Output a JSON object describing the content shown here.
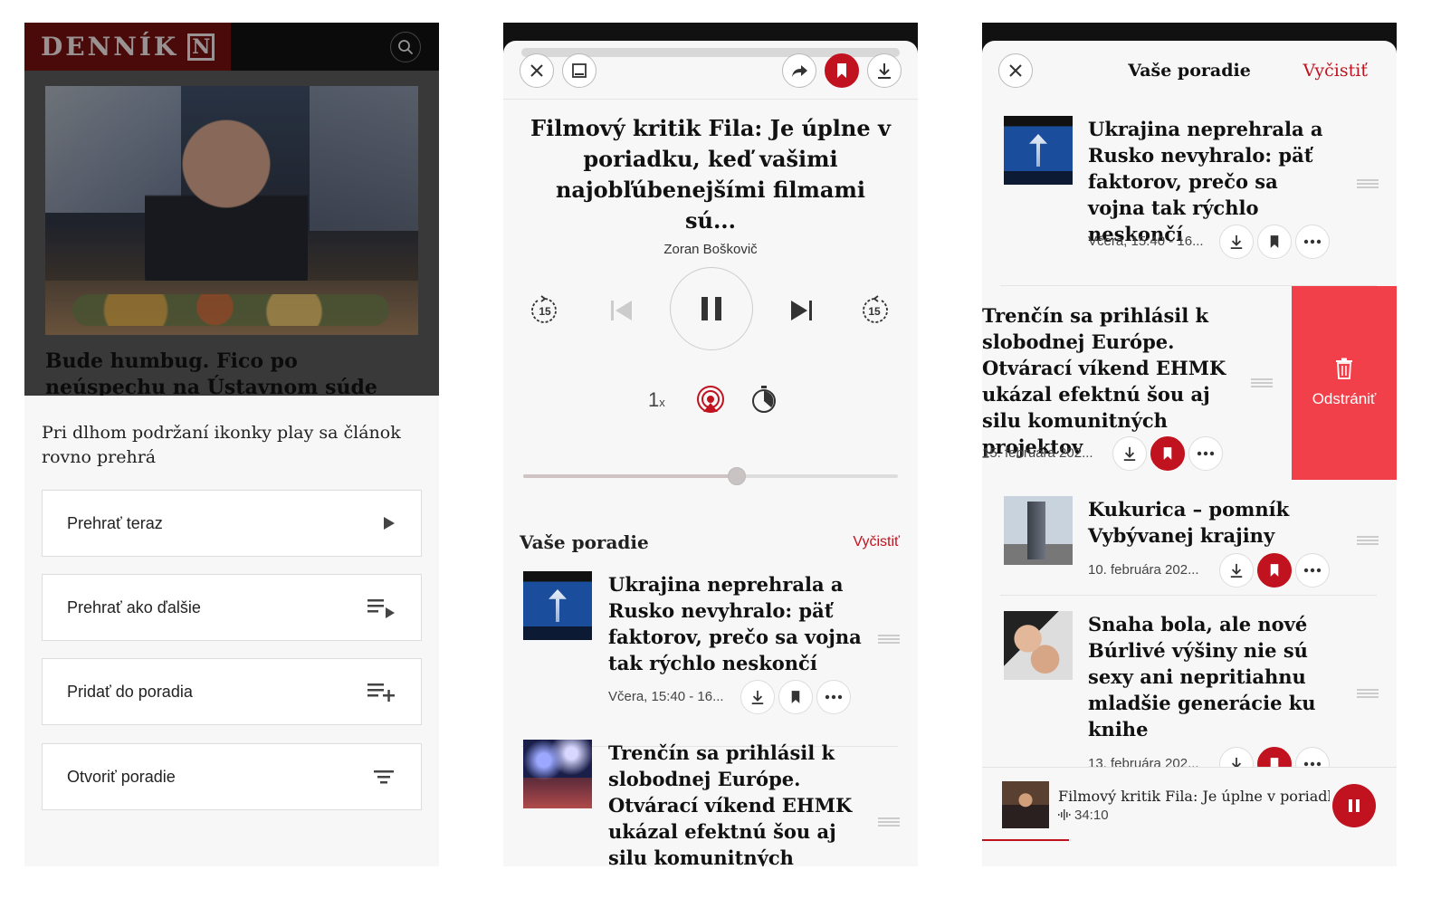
{
  "screen1": {
    "logo": "DENNÍK",
    "logo_letter": "N",
    "headline": "Bude humbug. Fico po neúspechu na Ústavnom súde prikazuje ministrom",
    "sheet": {
      "hint": "Pri dlhom podržaní ikonky play sa článok rovno prehrá",
      "options": [
        {
          "label": "Prehrať teraz",
          "icon": "play-icon"
        },
        {
          "label": "Prehrať ako ďalšie",
          "icon": "play-next-icon"
        },
        {
          "label": "Pridať do poradia",
          "icon": "add-queue-icon"
        },
        {
          "label": "Otvoriť poradie",
          "icon": "queue-icon"
        }
      ]
    }
  },
  "screen2": {
    "title": "Filmový kritik Fila: Je úplne v poriadku, keď vašimi najobľúbenejšími filmami sú...",
    "author": "Zoran Boškovič",
    "skip_back_seconds": "15",
    "skip_forward_seconds": "15",
    "speed": "1",
    "speed_suffix": "x",
    "progress": 0.57,
    "queue_heading": "Vaše poradie",
    "queue_clear": "Vyčistiť",
    "queue": [
      {
        "title": "Ukrajina neprehrala a Rusko nevyhralo: päť faktorov, prečo sa vojna tak rýchlo neskončí",
        "meta": "Včera, 15:40 - 16...",
        "saved": false
      },
      {
        "title": "Trenčín sa prihlásil k slobodnej Európe. Otvárací víkend EHMK ukázal efektnú šou aj silu komunitných projektov",
        "meta": "",
        "saved": false
      }
    ]
  },
  "screen3": {
    "title": "Vaše poradie",
    "clear": "Vyčistiť",
    "remove_label": "Odstrániť",
    "items": [
      {
        "title": "Ukrajina neprehrala a Rusko nevyhralo: päť faktorov, prečo sa vojna tak rýchlo neskončí",
        "meta": "Včera, 15:40 - 16...",
        "saved": false
      },
      {
        "title": "Trenčín sa prihlásil k slobodnej Európe. Otvárací víkend EHMK ukázal efektnú šou aj silu komunitných projektov",
        "meta": "15. februára 202...",
        "saved": true
      },
      {
        "title": "Kukurica – pomník Vybývanej krajiny",
        "meta": "10. februára 202...",
        "saved": true
      },
      {
        "title": "Snaha bola, ale nové Búrlivé výšiny nie sú sexy ani nepritiahnu mladšie generácie ku knihe",
        "meta": "13. februára 202...",
        "saved": true
      }
    ],
    "mini_player": {
      "title": "Filmový kritik Fila: Je úplne v poriadk...",
      "time": "34:10",
      "progress": 0.21
    }
  },
  "colors": {
    "accent": "#c1121f",
    "remove": "#f2404a",
    "logo_bg": "#6e1010"
  }
}
